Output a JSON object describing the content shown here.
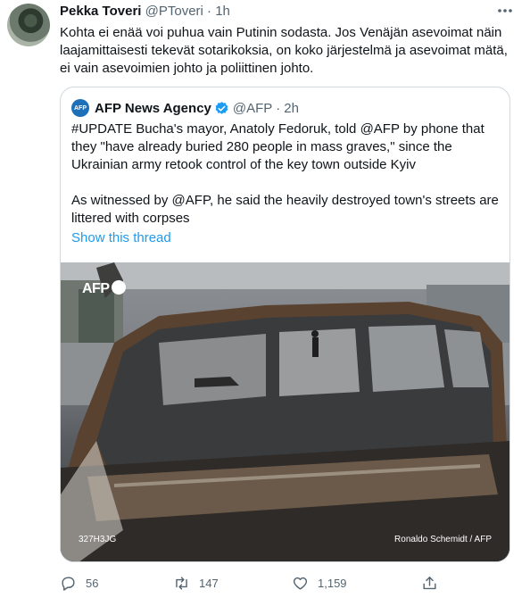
{
  "tweet": {
    "author_name": "Pekka Toveri",
    "author_handle": "@PToveri",
    "separator": "·",
    "time": "1h",
    "text": "Kohta ei enää voi puhua vain Putinin sodasta. Jos Venäjän asevoimat näin laajamittaisesti tekevät sotarikoksia, on koko järjestelmä ja asevoimat mätä, ei vain asevoimien johto ja poliittinen johto.",
    "more_icon": "more-icon"
  },
  "quote": {
    "logo_text": "AFP",
    "author_name": "AFP News Agency",
    "author_handle": "@AFP",
    "separator": "·",
    "time": "2h",
    "paragraph1": "#UPDATE Bucha's mayor, Anatoly Fedoruk, told @AFP by phone that they \"have already buried 280 people in mass graves,\" since the Ukrainian army retook control of the key town outside Kyiv",
    "paragraph2": "As witnessed by @AFP, he said the heavily destroyed town's streets are littered with corpses",
    "show_thread": "Show this thread",
    "photo": {
      "logo": "AFP",
      "id": "327H3JG",
      "credit": "Ronaldo Schemidt / AFP"
    }
  },
  "actions": {
    "replies": "56",
    "retweets": "147",
    "likes": "1,159"
  },
  "colors": {
    "link": "#1d9bf0",
    "muted": "#536471",
    "border": "#cfd9de",
    "verified": "#1d9bf0"
  }
}
